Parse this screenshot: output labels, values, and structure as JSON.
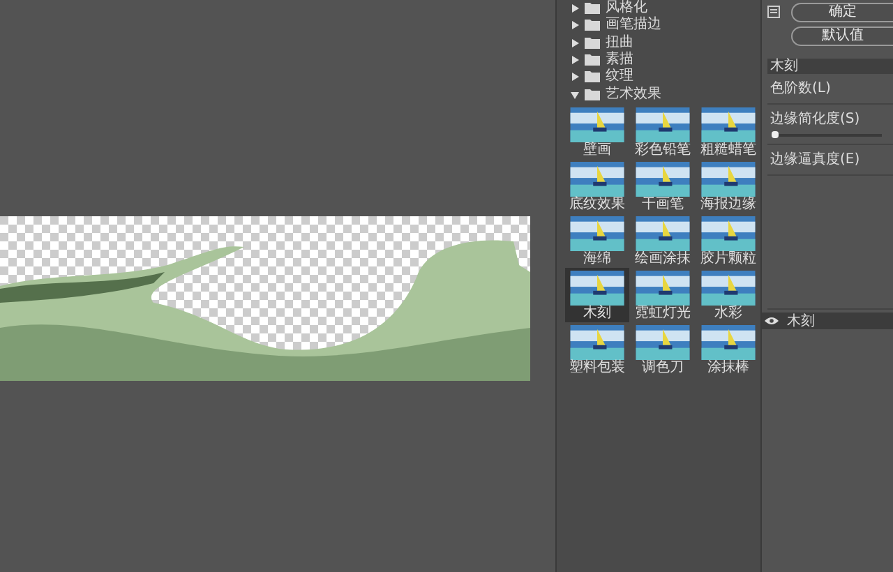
{
  "categories": [
    {
      "label": "风格化",
      "expanded": false
    },
    {
      "label": "画笔描边",
      "expanded": false
    },
    {
      "label": "扭曲",
      "expanded": false
    },
    {
      "label": "素描",
      "expanded": false
    },
    {
      "label": "纹理",
      "expanded": false
    },
    {
      "label": "艺术效果",
      "expanded": true,
      "filters": [
        {
          "label": "壁画",
          "selected": false
        },
        {
          "label": "彩色铅笔",
          "selected": false
        },
        {
          "label": "粗糙蜡笔",
          "selected": false
        },
        {
          "label": "底纹效果",
          "selected": false
        },
        {
          "label": "干画笔",
          "selected": false
        },
        {
          "label": "海报边缘",
          "selected": false
        },
        {
          "label": "海绵",
          "selected": false
        },
        {
          "label": "绘画涂抹",
          "selected": false
        },
        {
          "label": "胶片颗粒",
          "selected": false
        },
        {
          "label": "木刻",
          "selected": true
        },
        {
          "label": "霓虹灯光",
          "selected": false
        },
        {
          "label": "水彩",
          "selected": false
        },
        {
          "label": "塑料包装",
          "selected": false
        },
        {
          "label": "调色刀",
          "selected": false
        },
        {
          "label": "涂抹棒",
          "selected": false
        }
      ]
    }
  ],
  "buttons": [
    "确定",
    "默认值"
  ],
  "settings": {
    "title": "木刻",
    "controls": [
      {
        "label": "色阶数(L)",
        "kind": "label"
      },
      {
        "label": "边缘简化度(S)",
        "kind": "slider",
        "level": 0
      },
      {
        "label": "边缘逼真度(E)",
        "kind": "label"
      }
    ]
  },
  "effect_layers": [
    {
      "label": "木刻",
      "visible": true
    }
  ]
}
